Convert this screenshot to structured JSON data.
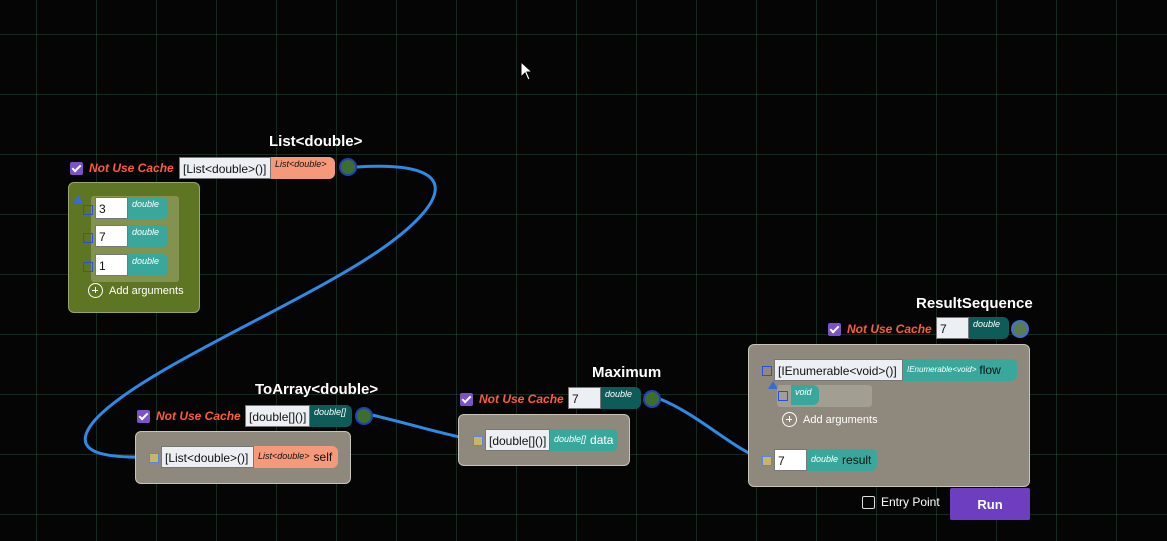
{
  "colors": {
    "wire": "#2e8ae6",
    "cache_label": "#ff5a3a",
    "checkbox": "#7b52c9",
    "run_button": "#6d3fc0",
    "olive_node": "#5e7624",
    "grey_node": "#8f887c",
    "teal_tag": "#3aa79d",
    "dark_teal_tag": "#0d5c5a",
    "salmon_tag": "#f6987a"
  },
  "list_node": {
    "title": "List<double>",
    "cache_label": "Not Use Cache",
    "value": "[List<double>()]",
    "type_tag": "List<double>",
    "args": [
      {
        "value": "3",
        "type": "double"
      },
      {
        "value": "7",
        "type": "double"
      },
      {
        "value": "1",
        "type": "double"
      }
    ],
    "add_arguments": "Add arguments"
  },
  "toarray_node": {
    "title": "ToArray<double>",
    "cache_label": "Not Use Cache",
    "value": "[double[]()]",
    "type_tag": "double[]",
    "input": {
      "value": "[List<double>()]",
      "type": "List<double>",
      "name": "self"
    }
  },
  "maximum_node": {
    "title": "Maximum",
    "cache_label": "Not Use Cache",
    "value": "7",
    "type_tag": "double",
    "input": {
      "value": "[double[]()]",
      "type": "double[]",
      "name": "data"
    }
  },
  "result_node": {
    "title": "ResultSequence",
    "cache_label": "Not Use Cache",
    "value": "7",
    "type_tag": "double",
    "flow": {
      "value": "[IEnumerable<void>()]",
      "type": "IEnumerable<void>",
      "name": "flow"
    },
    "void_arg": {
      "type": "void"
    },
    "add_arguments": "Add arguments",
    "result": {
      "value": "7",
      "type": "double",
      "name": "result"
    },
    "entry_point": "Entry Point",
    "run": "Run"
  },
  "icons": [
    "checkbox-icon",
    "plus-circle-icon",
    "output-port-icon",
    "input-port-icon",
    "collapse-triangle-icon",
    "mouse-cursor-icon"
  ]
}
